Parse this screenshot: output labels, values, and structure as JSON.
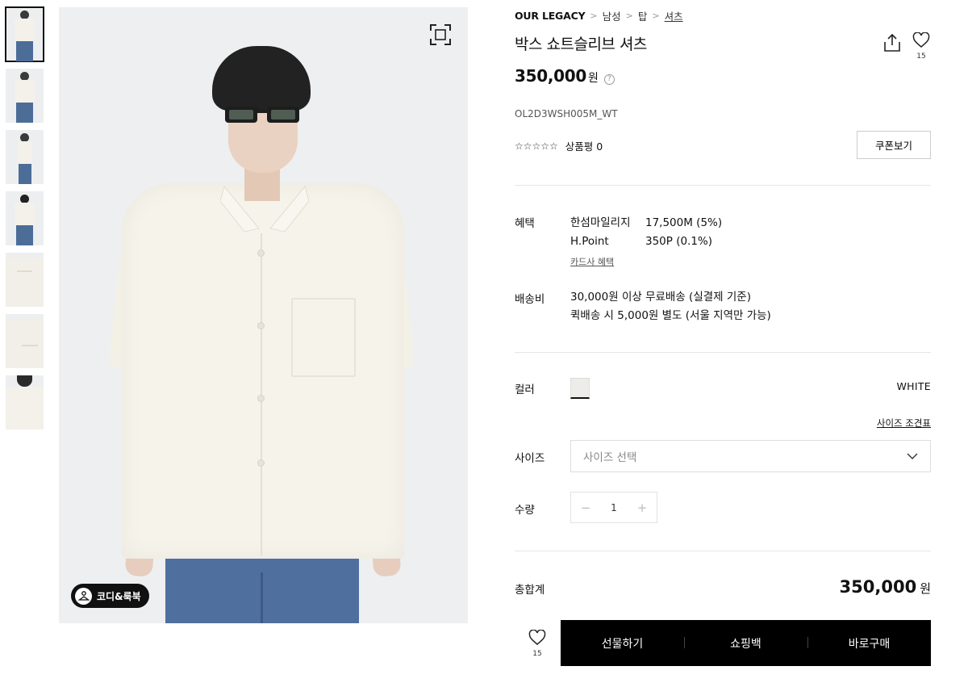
{
  "gallery": {
    "thumbnails": [
      "thumb-front-cropped",
      "thumb-full-front",
      "thumb-side",
      "thumb-back",
      "thumb-collar-detail",
      "thumb-sleeve-detail",
      "thumb-back-detail"
    ],
    "codi_button_label": "코디&룩북",
    "expand_icon": "expand-icon"
  },
  "breadcrumb": {
    "brand": "OUR LEGACY",
    "items": [
      "남성",
      "탑",
      "셔츠"
    ]
  },
  "product": {
    "title": "박스 쇼트슬리브 셔츠",
    "price": "350,000",
    "price_unit": "원",
    "price_help": "?",
    "sku": "OL2D3WSH005M_WT",
    "stars": "☆☆☆☆☆",
    "review_label": "상품평 0",
    "coupon_button": "쿠폰보기",
    "like_count": "15"
  },
  "benefits": {
    "label": "혜택",
    "rows": [
      {
        "name": "한섬마일리지",
        "value": "17,500M (5%)"
      },
      {
        "name": "H.Point",
        "value": "350P (0.1%)"
      }
    ],
    "card_link": "카드사 혜택"
  },
  "shipping": {
    "label": "배송비",
    "lines": [
      "30,000원 이상 무료배송 (실결제 기준)",
      "퀵배송 시 5,000원 별도 (서울 지역만 가능)"
    ]
  },
  "options": {
    "color_label": "컬러",
    "color_value": "WHITE",
    "color_swatch": "#eeece9",
    "size_chart_link": "사이즈 조견표",
    "size_label": "사이즈",
    "size_placeholder": "사이즈 선택",
    "qty_label": "수량",
    "qty_value": "1",
    "qty_minus": "−",
    "qty_plus": "+"
  },
  "total": {
    "label": "총합계",
    "price": "350,000",
    "unit": "원"
  },
  "actions": {
    "like_count": "15",
    "gift": "선물하기",
    "cart": "쇼핑백",
    "buy": "바로구매"
  }
}
